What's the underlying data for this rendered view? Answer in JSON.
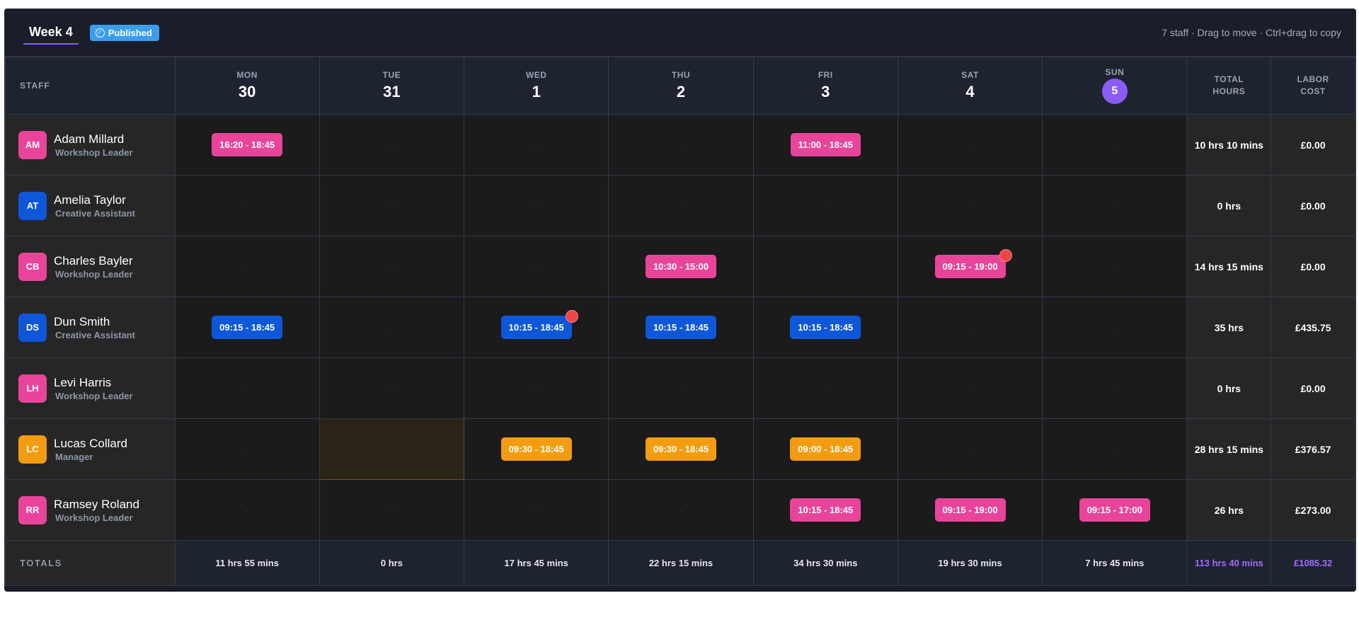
{
  "header": {
    "week_label": "Week 4",
    "published_label": "Published",
    "hint": "7 staff · Drag to move · Ctrl+drag to copy"
  },
  "columns": {
    "staff": "STAFF",
    "total_hours": [
      "TOTAL",
      "HOURS"
    ],
    "labor_cost": [
      "LABOR",
      "COST"
    ]
  },
  "days": [
    {
      "name": "MON",
      "date": "30",
      "today": false
    },
    {
      "name": "TUE",
      "date": "31",
      "today": false
    },
    {
      "name": "WED",
      "date": "1",
      "today": false
    },
    {
      "name": "THU",
      "date": "2",
      "today": false
    },
    {
      "name": "FRI",
      "date": "3",
      "today": false
    },
    {
      "name": "SAT",
      "date": "4",
      "today": false
    },
    {
      "name": "SUN",
      "date": "5",
      "today": true
    }
  ],
  "empty_marker": "·",
  "colors": {
    "pink": "#e8459a",
    "blue": "#0f57d9",
    "orange": "#f39c11",
    "accent": "#8b5cf6",
    "alert": "#ef4444",
    "published": "#3b9ded"
  },
  "staff": [
    {
      "initials": "AM",
      "name": "Adam Millard",
      "role": "Workshop Leader",
      "color": "#e8459a",
      "shifts": [
        "16:20 - 18:45",
        null,
        null,
        null,
        "11:00 - 18:45",
        null,
        null
      ],
      "alerts": [
        false,
        false,
        false,
        false,
        false,
        false,
        false
      ],
      "highlight": [
        false,
        false,
        false,
        false,
        false,
        false,
        false
      ],
      "total": "10 hrs 10 mins",
      "cost": "£0.00"
    },
    {
      "initials": "AT",
      "name": "Amelia Taylor",
      "role": "Creative Assistant",
      "color": "#0f57d9",
      "shifts": [
        null,
        null,
        null,
        null,
        null,
        null,
        null
      ],
      "alerts": [
        false,
        false,
        false,
        false,
        false,
        false,
        false
      ],
      "highlight": [
        false,
        false,
        false,
        false,
        false,
        false,
        false
      ],
      "total": "0 hrs",
      "cost": "£0.00"
    },
    {
      "initials": "CB",
      "name": "Charles Bayler",
      "role": "Workshop Leader",
      "color": "#e8459a",
      "shifts": [
        null,
        null,
        null,
        "10:30 - 15:00",
        null,
        "09:15 - 19:00",
        null
      ],
      "alerts": [
        false,
        false,
        false,
        false,
        false,
        true,
        false
      ],
      "highlight": [
        false,
        false,
        false,
        false,
        false,
        false,
        false
      ],
      "total": "14 hrs 15 mins",
      "cost": "£0.00"
    },
    {
      "initials": "DS",
      "name": "Dun Smith",
      "role": "Creative Assistant",
      "color": "#0f57d9",
      "shifts": [
        "09:15 - 18:45",
        null,
        "10:15 - 18:45",
        "10:15 - 18:45",
        "10:15 - 18:45",
        null,
        null
      ],
      "alerts": [
        false,
        false,
        true,
        false,
        false,
        false,
        false
      ],
      "highlight": [
        false,
        false,
        false,
        false,
        false,
        false,
        false
      ],
      "total": "35 hrs",
      "cost": "£435.75"
    },
    {
      "initials": "LH",
      "name": "Levi Harris",
      "role": "Workshop Leader",
      "color": "#e8459a",
      "shifts": [
        null,
        null,
        null,
        null,
        null,
        null,
        null
      ],
      "alerts": [
        false,
        false,
        false,
        false,
        false,
        false,
        false
      ],
      "highlight": [
        false,
        false,
        false,
        false,
        false,
        false,
        false
      ],
      "total": "0 hrs",
      "cost": "£0.00"
    },
    {
      "initials": "LC",
      "name": "Lucas Collard",
      "role": "Manager",
      "color": "#f39c11",
      "shifts": [
        null,
        null,
        "09:30 - 18:45",
        "09:30 - 18:45",
        "09:00 - 18:45",
        null,
        null
      ],
      "alerts": [
        false,
        false,
        false,
        false,
        false,
        false,
        false
      ],
      "highlight": [
        false,
        true,
        false,
        false,
        false,
        false,
        false
      ],
      "total": "28 hrs 15 mins",
      "cost": "£376.57"
    },
    {
      "initials": "RR",
      "name": "Ramsey Roland",
      "role": "Workshop Leader",
      "color": "#e8459a",
      "shifts": [
        null,
        null,
        null,
        null,
        "10:15 - 18:45",
        "09:15 - 19:00",
        "09:15 - 17:00"
      ],
      "alerts": [
        false,
        false,
        false,
        false,
        false,
        false,
        false
      ],
      "highlight": [
        false,
        false,
        false,
        false,
        false,
        false,
        false
      ],
      "total": "26 hrs",
      "cost": "£273.00"
    }
  ],
  "totals": {
    "label": "TOTALS",
    "days": [
      "11 hrs 55 mins",
      "0 hrs",
      "17 hrs 45 mins",
      "22 hrs 15 mins",
      "34 hrs 30 mins",
      "19 hrs 30 mins",
      "7 hrs 45 mins"
    ],
    "hours": "113 hrs 40 mins",
    "cost": "£1085.32"
  }
}
